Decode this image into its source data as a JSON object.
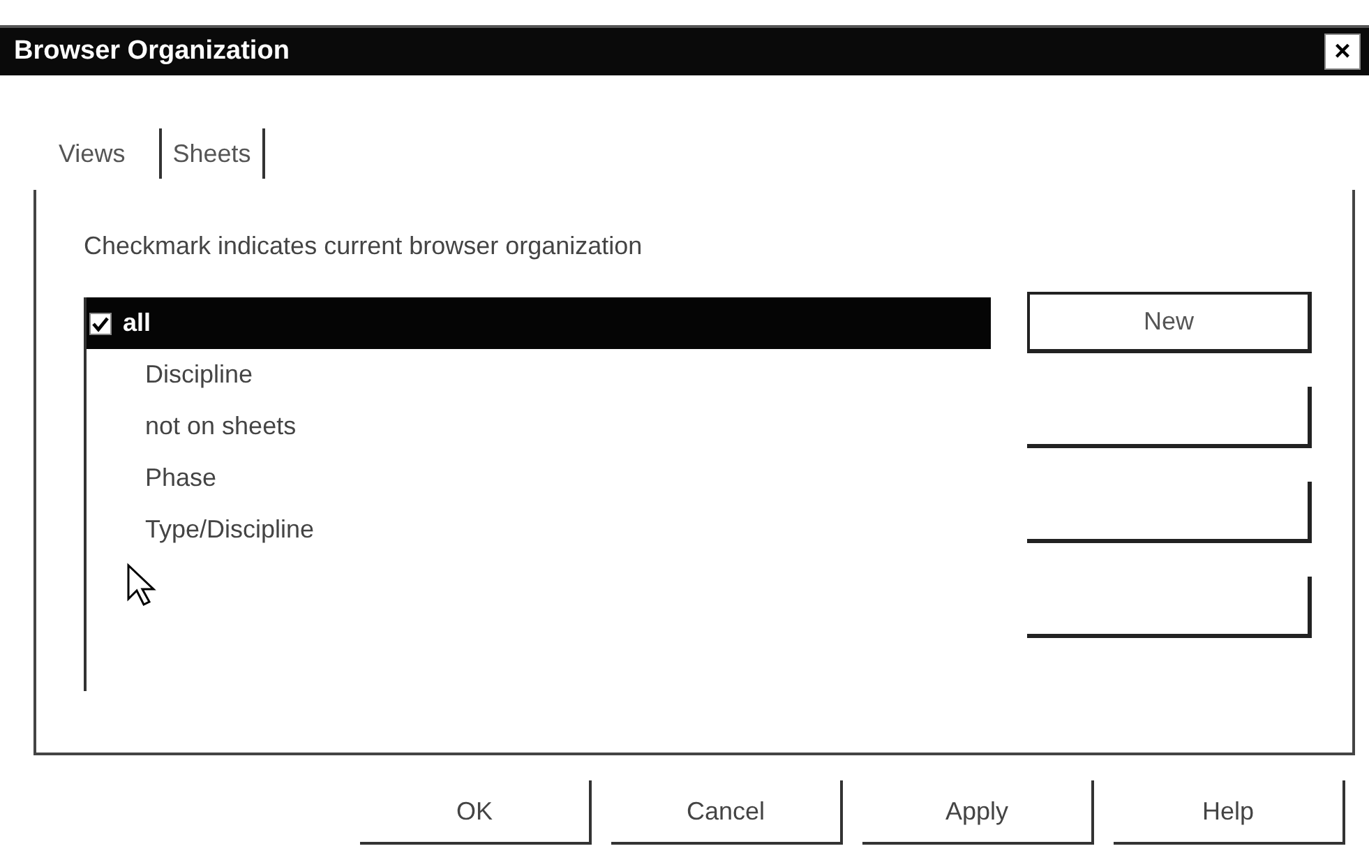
{
  "window": {
    "title": "Browser Organization",
    "close": "×"
  },
  "tabs": [
    {
      "label": "Views",
      "selected": true
    },
    {
      "label": "Sheets",
      "selected": false
    }
  ],
  "instruction": "Checkmark indicates current browser organization",
  "list": [
    {
      "label": "all",
      "checked": true,
      "selected": true
    },
    {
      "label": "Discipline",
      "checked": false,
      "selected": false
    },
    {
      "label": "not on sheets",
      "checked": false,
      "selected": false
    },
    {
      "label": "Phase",
      "checked": false,
      "selected": false
    },
    {
      "label": "Type/Discipline",
      "checked": false,
      "selected": false
    }
  ],
  "side_buttons": [
    {
      "label": "New",
      "disabled": false
    },
    {
      "disabled": true
    },
    {
      "disabled": true
    },
    {
      "disabled": true
    }
  ],
  "buttons": [
    "OK",
    "Cancel",
    "Apply",
    "Help"
  ]
}
